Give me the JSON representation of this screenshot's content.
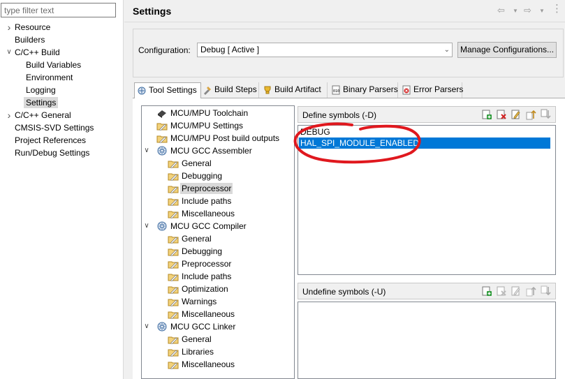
{
  "filter": {
    "placeholder": "type filter text"
  },
  "nav": {
    "items": [
      {
        "label": "Resource",
        "twisty": ">"
      },
      {
        "label": "Builders",
        "twisty": ""
      },
      {
        "label": "C/C++ Build",
        "twisty": "v"
      },
      {
        "label": "Build Variables",
        "twisty": ""
      },
      {
        "label": "Environment",
        "twisty": ""
      },
      {
        "label": "Logging",
        "twisty": ""
      },
      {
        "label": "Settings",
        "twisty": "",
        "selected": true
      },
      {
        "label": "C/C++ General",
        "twisty": ">"
      },
      {
        "label": "CMSIS-SVD Settings",
        "twisty": ""
      },
      {
        "label": "Project References",
        "twisty": ""
      },
      {
        "label": "Run/Debug Settings",
        "twisty": ""
      }
    ]
  },
  "header": {
    "title": "Settings"
  },
  "config": {
    "label": "Configuration:",
    "value": "Debug  [ Active ]",
    "manage_label": "Manage Configurations..."
  },
  "tabs": [
    {
      "label": "Tool Settings",
      "active": true,
      "icon": "tool-settings-icon"
    },
    {
      "label": "Build Steps",
      "icon": "build-steps-icon"
    },
    {
      "label": "Build Artifact",
      "icon": "build-artifact-icon"
    },
    {
      "label": "Binary Parsers",
      "icon": "binary-parsers-icon"
    },
    {
      "label": "Error Parsers",
      "icon": "error-parsers-icon"
    }
  ],
  "tree": [
    {
      "label": "MCU/MPU Toolchain",
      "icon": "chip-icon"
    },
    {
      "label": "MCU/MPU Settings",
      "icon": "options-icon"
    },
    {
      "label": "MCU/MPU Post build outputs",
      "icon": "options-icon"
    },
    {
      "label": "MCU GCC Assembler",
      "icon": "tool-icon",
      "twisty": "v"
    },
    {
      "label": "General",
      "icon": "options-icon"
    },
    {
      "label": "Debugging",
      "icon": "options-icon"
    },
    {
      "label": "Preprocessor",
      "icon": "options-icon",
      "selected": true
    },
    {
      "label": "Include paths",
      "icon": "options-icon"
    },
    {
      "label": "Miscellaneous",
      "icon": "options-icon"
    },
    {
      "label": "MCU GCC Compiler",
      "icon": "tool-icon",
      "twisty": "v"
    },
    {
      "label": "General",
      "icon": "options-icon"
    },
    {
      "label": "Debugging",
      "icon": "options-icon"
    },
    {
      "label": "Preprocessor",
      "icon": "options-icon"
    },
    {
      "label": "Include paths",
      "icon": "options-icon"
    },
    {
      "label": "Optimization",
      "icon": "options-icon"
    },
    {
      "label": "Warnings",
      "icon": "options-icon"
    },
    {
      "label": "Miscellaneous",
      "icon": "options-icon"
    },
    {
      "label": "MCU GCC Linker",
      "icon": "tool-icon",
      "twisty": "v"
    },
    {
      "label": "General",
      "icon": "options-icon"
    },
    {
      "label": "Libraries",
      "icon": "options-icon"
    },
    {
      "label": "Miscellaneous",
      "icon": "options-icon"
    }
  ],
  "define": {
    "label": "Define symbols (-D)",
    "items": [
      {
        "value": "DEBUG"
      },
      {
        "value": "HAL_SPI_MODULE_ENABLED",
        "selected": true
      }
    ]
  },
  "undefine": {
    "label": "Undefine symbols (-U)",
    "items": []
  },
  "annotation": {
    "color": "#e0181e",
    "shape": "freehand-circle"
  },
  "colors": {
    "selection": "#0078d7",
    "tree_selection": "#d9d9d9"
  }
}
